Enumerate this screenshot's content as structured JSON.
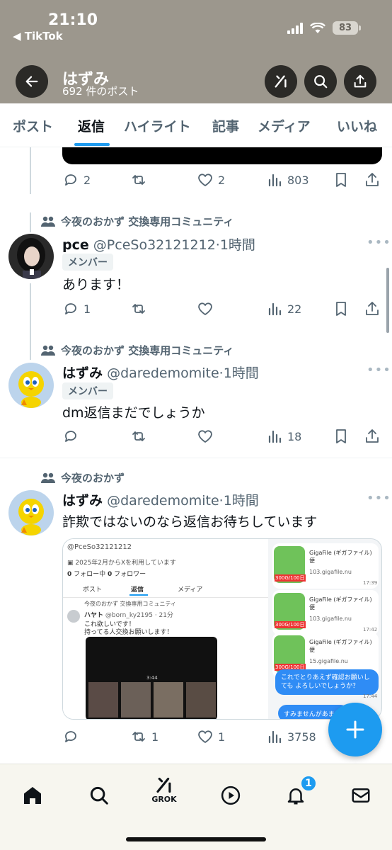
{
  "status": {
    "time": "21:10",
    "back_app": "◀ TikTok",
    "battery": "83"
  },
  "header": {
    "title": "はずみ",
    "subtitle": "692 件のポスト"
  },
  "tabs": [
    "ポスト",
    "返信",
    "ハイライト",
    "記事",
    "メディア",
    "いいね"
  ],
  "active_tab": "返信",
  "posts": [
    {
      "actions": {
        "reply": "2",
        "repost": "",
        "like": "2",
        "views": "803"
      }
    },
    {
      "community": "今夜のおかず 交換専用コミュニティ",
      "name": "pce",
      "handle": "@PceSo32121212",
      "time": "·1時間",
      "badge": "メンバー",
      "text": "あります！",
      "actions": {
        "reply": "1",
        "repost": "",
        "like": "",
        "views": "22"
      }
    },
    {
      "community": "今夜のおかず 交換専用コミュニティ",
      "name": "はずみ",
      "handle": "@daredemomite",
      "time": "·1時間",
      "badge": "メンバー",
      "text": "dm返信まだでしょうか",
      "actions": {
        "reply": "",
        "repost": "",
        "like": "",
        "views": "18"
      }
    },
    {
      "community": "今夜のおかず",
      "name": "はずみ",
      "handle": "@daredemomite",
      "time": "·1時間",
      "text": "詐欺ではないのなら返信お待ちしています",
      "actions": {
        "reply": "",
        "repost": "1",
        "like": "1",
        "views": "3758"
      }
    }
  ],
  "embed": {
    "handle": "@PceSo32121212",
    "joined": "2025年2月からXを利用しています",
    "follow_count": "0",
    "follow_label": "フォロー中",
    "follower_count": "0",
    "follower_label": "フォロワー",
    "tabs": [
      "ポスト",
      "返信",
      "メディア"
    ],
    "inner_community": "今夜のおかず 交換専用コミュニティ",
    "inner_name": "ハヤト",
    "inner_handle": "@born_ky2195 · 21分",
    "inner_text1": "これ欲しいです！",
    "inner_text2": "持ってる人交換お願いします！",
    "video_label": "3:44",
    "messages": [
      {
        "title": "GigaFile (ギガファイル) 便",
        "url": "103.gigafile.nu",
        "time": "17:39",
        "thumb_label": "300G/100日"
      },
      {
        "title": "GigaFile (ギガファイル) 便",
        "url": "103.gigafile.nu",
        "time": "17:42",
        "thumb_label": "300G/100日"
      },
      {
        "title": "GigaFile (ギガファイル) 便",
        "url": "15.gigafile.nu",
        "time": "17:44",
        "thumb_label": "300G/100日"
      }
    ],
    "bubble1": "これでとりあえず確認お願いしても よろしいでしょうか？",
    "bubble2": "すみませんがあま"
  },
  "nav": {
    "grok_label": "GROK",
    "notif_count": "1"
  },
  "colors": {
    "accent": "#1d9bf0",
    "header_bg": "#9c978d",
    "muted": "#536471"
  }
}
